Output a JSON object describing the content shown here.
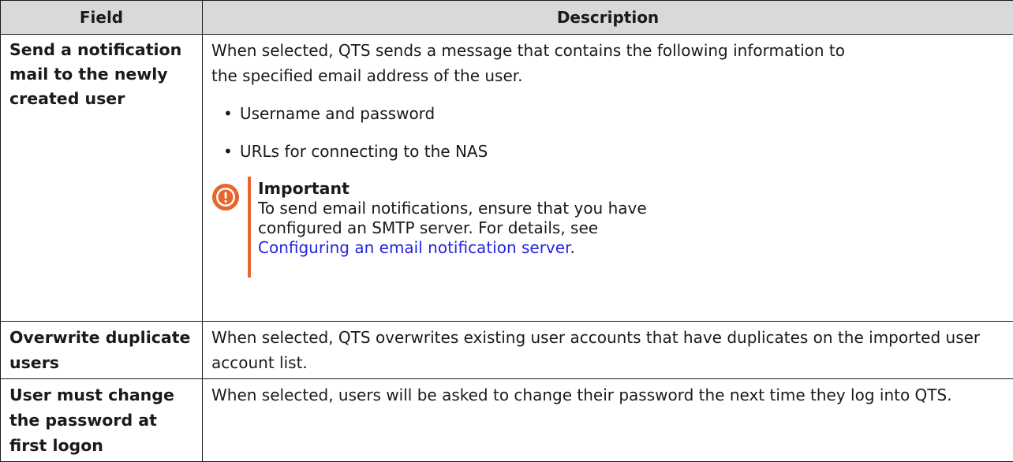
{
  "table": {
    "headers": {
      "field": "Field",
      "description": "Description"
    },
    "rows": [
      {
        "field": "Send a notification mail to the newly created user",
        "description": "When selected, QTS sends a message that contains the following information to the specified email address of the user.",
        "bullets": [
          "Username and password",
          "URLs for connecting to the NAS"
        ],
        "note": {
          "title": "Important",
          "text_before": "To send email notifications, ensure that you have configured an SMTP server. For details, see ",
          "link": "Configuring an email notification server",
          "text_after": "."
        }
      },
      {
        "field": "Overwrite duplicate users",
        "description": "When selected, QTS overwrites existing user accounts that have duplicates on the imported user account list."
      },
      {
        "field": "User must change the password at first logon",
        "description": "When selected, users will be asked to change their password the next time they log into QTS."
      }
    ]
  },
  "colors": {
    "header_bg": "#d9d9d9",
    "border": "#1a1a1a",
    "note_accent": "#e8662d",
    "link": "#2525e0"
  },
  "icons": {
    "note_icon": "important-exclamation-icon",
    "bullet": "•"
  }
}
